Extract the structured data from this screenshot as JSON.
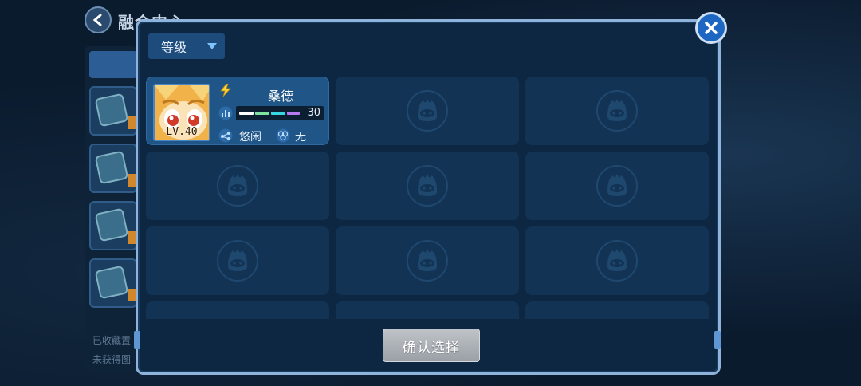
{
  "background": {
    "title": "融合中心",
    "footer_line1": "已收藏置",
    "footer_line2": "未获得图"
  },
  "dialog": {
    "sort_dropdown": {
      "selected": "等级"
    },
    "pet": {
      "name": "桑德",
      "level": "LV.40",
      "stat_value": "30",
      "trait_1": "悠闲",
      "trait_2": "无"
    },
    "confirm_label": "确认选择"
  },
  "colors": {
    "accent": "#1d67c2",
    "card": "#1f5587",
    "seg_white": "#ffffff",
    "seg_green": "#7ee3a0",
    "seg_cyan": "#38d6e0",
    "seg_purple": "#b57af0"
  }
}
